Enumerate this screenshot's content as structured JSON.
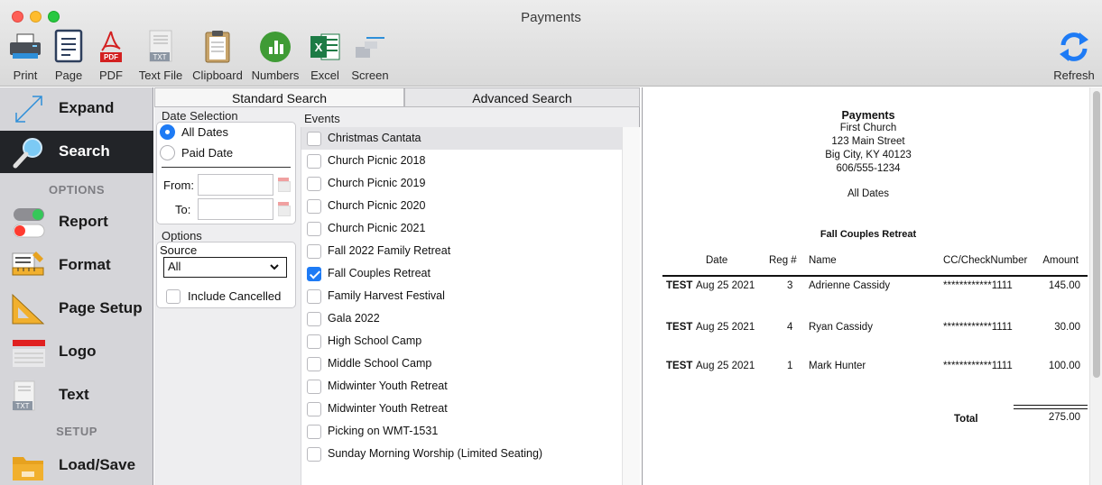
{
  "window": {
    "title": "Payments"
  },
  "toolbar": {
    "items": [
      {
        "label": "Print",
        "icon": "printer-icon"
      },
      {
        "label": "Page",
        "icon": "page-icon"
      },
      {
        "label": "PDF",
        "icon": "pdf-icon"
      },
      {
        "label": "Text File",
        "icon": "text-file-icon"
      },
      {
        "label": "Clipboard",
        "icon": "clipboard-icon"
      },
      {
        "label": "Numbers",
        "icon": "numbers-icon"
      },
      {
        "label": "Excel",
        "icon": "excel-icon"
      },
      {
        "label": "Screen",
        "icon": "screen-icon"
      }
    ],
    "refresh_label": "Refresh",
    "pdf_badge": "PDF",
    "txt_badge": "TXT",
    "excel_badge": "X"
  },
  "sidebar": {
    "items": [
      {
        "label": "Expand",
        "icon": "expand-arrows-icon"
      },
      {
        "label": "Search",
        "icon": "magnifier-icon",
        "active": true
      }
    ],
    "options_heading": "OPTIONS",
    "option_items": [
      {
        "label": "Report",
        "icon": "toggle-switches-icon"
      },
      {
        "label": "Format",
        "icon": "format-ruler-icon"
      },
      {
        "label": "Page Setup",
        "icon": "triangle-ruler-icon"
      },
      {
        "label": "Logo",
        "icon": "logo-banner-icon"
      },
      {
        "label": "Text",
        "icon": "txt-document-icon"
      }
    ],
    "setup_heading": "SETUP",
    "setup_items": [
      {
        "label": "Load/Save",
        "icon": "folder-icon"
      }
    ],
    "txt_badge": "TXT"
  },
  "search": {
    "tabs": [
      "Standard Search",
      "Advanced Search"
    ],
    "date_selection": {
      "title": "Date Selection",
      "options": [
        "All Dates",
        "Paid Date"
      ],
      "selected": "All Dates",
      "from_label": "From:",
      "to_label": "To:",
      "from_value": "",
      "to_value": ""
    },
    "options": {
      "title": "Options",
      "source_label": "Source",
      "source_value": "All",
      "include_cancelled_label": "Include Cancelled",
      "include_cancelled": false
    },
    "events": {
      "title": "Events",
      "items": [
        {
          "label": "Christmas Cantata",
          "checked": false
        },
        {
          "label": "Church Picnic 2018",
          "checked": false
        },
        {
          "label": "Church Picnic 2019",
          "checked": false
        },
        {
          "label": "Church Picnic 2020",
          "checked": false
        },
        {
          "label": "Church Picnic 2021",
          "checked": false
        },
        {
          "label": "Fall 2022 Family Retreat",
          "checked": false
        },
        {
          "label": "Fall Couples Retreat",
          "checked": true
        },
        {
          "label": "Family Harvest Festival",
          "checked": false
        },
        {
          "label": "Gala 2022",
          "checked": false
        },
        {
          "label": "High School Camp",
          "checked": false
        },
        {
          "label": "Middle School Camp",
          "checked": false
        },
        {
          "label": "Midwinter Youth Retreat",
          "checked": false
        },
        {
          "label": "Midwinter Youth Retreat",
          "checked": false
        },
        {
          "label": "Picking on WMT-1531",
          "checked": false
        },
        {
          "label": "Sunday Morning Worship (Limited Seating)",
          "checked": false
        }
      ]
    }
  },
  "report": {
    "title": "Payments",
    "org_lines": [
      "First Church",
      "123 Main Street",
      "Big City, KY  40123",
      "606/555-1234"
    ],
    "date_filter": "All Dates",
    "event_title": "Fall Couples Retreat",
    "columns": {
      "date": "Date",
      "reg": "Reg #",
      "name": "Name",
      "cc": "CC/CheckNumber",
      "amount": "Amount"
    },
    "rows": [
      {
        "tag": "TEST",
        "date": "Aug 25 2021",
        "reg": "3",
        "name": "Adrienne Cassidy",
        "cc": "************1111",
        "amount": "145.00"
      },
      {
        "tag": "TEST",
        "date": "Aug 25 2021",
        "reg": "4",
        "name": "Ryan Cassidy",
        "cc": "************1111",
        "amount": "30.00"
      },
      {
        "tag": "TEST",
        "date": "Aug 25 2021",
        "reg": "1",
        "name": "Mark Hunter",
        "cc": "************1111",
        "amount": "100.00"
      }
    ],
    "total_label": "Total",
    "total_value": "275.00"
  },
  "colors": {
    "accent": "#1e7bf5",
    "sidebar_active": "#222428",
    "sidebar_bg": "#d5d5d9",
    "numbers_green": "#3f9b35",
    "excel_green": "#1d7b45",
    "pdf_red": "#d32020"
  }
}
